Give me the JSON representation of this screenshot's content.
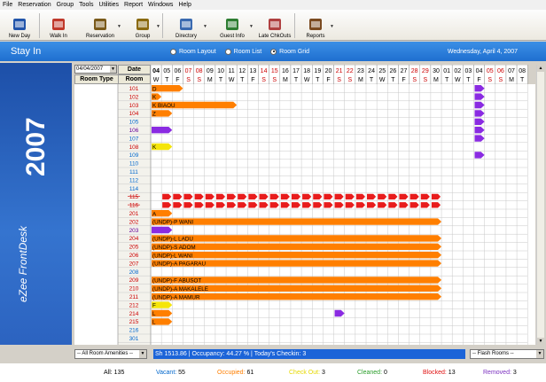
{
  "menu": [
    "File",
    "Reservation",
    "Group",
    "Tools",
    "Utilities",
    "Report",
    "Windows",
    "Help"
  ],
  "toolbar": [
    {
      "label": "New Day",
      "icon": "calendar-icon",
      "dropdown": false
    },
    {
      "label": "Walk In",
      "icon": "walk-in-icon",
      "dropdown": false
    },
    {
      "label": "Reservation",
      "icon": "reservation-icon",
      "dropdown": true
    },
    {
      "label": "Group",
      "icon": "group-icon",
      "dropdown": true
    },
    {
      "label": "Directory",
      "icon": "directory-icon",
      "dropdown": true
    },
    {
      "label": "Guest Info",
      "icon": "guest-info-icon",
      "dropdown": true
    },
    {
      "label": "Late ChkOuts",
      "icon": "late-checkout-icon",
      "dropdown": false
    },
    {
      "label": "Reports",
      "icon": "reports-icon",
      "dropdown": true
    }
  ],
  "window": {
    "title": "Stay In",
    "date": "Wednesday, April 4, 2007"
  },
  "view_options": [
    {
      "label": "Room Layout",
      "selected": false
    },
    {
      "label": "Room List",
      "selected": false
    },
    {
      "label": "Room Grid",
      "selected": true
    }
  ],
  "sidebar": {
    "logo_text": "eZee FrontDesk",
    "logo_year": "2007"
  },
  "grid": {
    "date_select": "04/04/2007",
    "date_header": "Date",
    "room_type_header": "Room Type",
    "room_header": "Room",
    "room_type_value": "",
    "days": [
      {
        "n": "04",
        "d": "W",
        "c": "#000"
      },
      {
        "n": "05",
        "d": "T",
        "c": "#000"
      },
      {
        "n": "06",
        "d": "F",
        "c": "#000"
      },
      {
        "n": "07",
        "d": "S",
        "c": "#c00"
      },
      {
        "n": "08",
        "d": "S",
        "c": "#c00"
      },
      {
        "n": "09",
        "d": "M",
        "c": "#000"
      },
      {
        "n": "10",
        "d": "T",
        "c": "#000"
      },
      {
        "n": "11",
        "d": "W",
        "c": "#000"
      },
      {
        "n": "12",
        "d": "T",
        "c": "#000"
      },
      {
        "n": "13",
        "d": "F",
        "c": "#000"
      },
      {
        "n": "14",
        "d": "S",
        "c": "#c00"
      },
      {
        "n": "15",
        "d": "S",
        "c": "#c00"
      },
      {
        "n": "16",
        "d": "M",
        "c": "#000"
      },
      {
        "n": "17",
        "d": "T",
        "c": "#000"
      },
      {
        "n": "18",
        "d": "W",
        "c": "#000"
      },
      {
        "n": "19",
        "d": "T",
        "c": "#000"
      },
      {
        "n": "20",
        "d": "F",
        "c": "#000"
      },
      {
        "n": "21",
        "d": "S",
        "c": "#c00"
      },
      {
        "n": "22",
        "d": "S",
        "c": "#c00"
      },
      {
        "n": "23",
        "d": "M",
        "c": "#000"
      },
      {
        "n": "24",
        "d": "T",
        "c": "#000"
      },
      {
        "n": "25",
        "d": "W",
        "c": "#000"
      },
      {
        "n": "26",
        "d": "T",
        "c": "#000"
      },
      {
        "n": "27",
        "d": "F",
        "c": "#000"
      },
      {
        "n": "28",
        "d": "S",
        "c": "#c00"
      },
      {
        "n": "29",
        "d": "S",
        "c": "#c00"
      },
      {
        "n": "30",
        "d": "M",
        "c": "#000"
      },
      {
        "n": "01",
        "d": "T",
        "c": "#000"
      },
      {
        "n": "02",
        "d": "W",
        "c": "#000"
      },
      {
        "n": "03",
        "d": "T",
        "c": "#000"
      },
      {
        "n": "04",
        "d": "F",
        "c": "#000"
      },
      {
        "n": "05",
        "d": "S",
        "c": "#c00"
      },
      {
        "n": "06",
        "d": "S",
        "c": "#c00"
      },
      {
        "n": "07",
        "d": "M",
        "c": "#000"
      },
      {
        "n": "08",
        "d": "T",
        "c": "#000"
      }
    ],
    "rooms": [
      {
        "no": "101",
        "c": "#c00"
      },
      {
        "no": "102",
        "c": "#c00"
      },
      {
        "no": "103",
        "c": "#c00"
      },
      {
        "no": "104",
        "c": "#c00"
      },
      {
        "no": "105",
        "c": "#06c"
      },
      {
        "no": "106",
        "c": "#609"
      },
      {
        "no": "107",
        "c": "#06c"
      },
      {
        "no": "108",
        "c": "#c00"
      },
      {
        "no": "109",
        "c": "#06c"
      },
      {
        "no": "110",
        "c": "#06c"
      },
      {
        "no": "111",
        "c": "#06c"
      },
      {
        "no": "112",
        "c": "#06c"
      },
      {
        "no": "114",
        "c": "#06c"
      },
      {
        "no": "115",
        "c": "#c00",
        "strike": true
      },
      {
        "no": "116",
        "c": "#c00",
        "strike": true
      },
      {
        "no": "201",
        "c": "#c00"
      },
      {
        "no": "202",
        "c": "#c00"
      },
      {
        "no": "203",
        "c": "#609"
      },
      {
        "no": "204",
        "c": "#c00"
      },
      {
        "no": "205",
        "c": "#c00"
      },
      {
        "no": "206",
        "c": "#c00"
      },
      {
        "no": "207",
        "c": "#c00"
      },
      {
        "no": "208",
        "c": "#06c"
      },
      {
        "no": "209",
        "c": "#c00"
      },
      {
        "no": "210",
        "c": "#c00"
      },
      {
        "no": "211",
        "c": "#c00"
      },
      {
        "no": "212",
        "c": "#c00"
      },
      {
        "no": "214",
        "c": "#c00"
      },
      {
        "no": "215",
        "c": "#c00"
      },
      {
        "no": "216",
        "c": "#06c"
      },
      {
        "no": "301",
        "c": "#06c"
      }
    ],
    "bookings": [
      {
        "row": 0,
        "start": 0,
        "end": 3,
        "color": "#ff7f00",
        "label": "D"
      },
      {
        "row": 1,
        "start": 0,
        "end": 1,
        "color": "#ff7f00",
        "label": "K"
      },
      {
        "row": 2,
        "start": 0,
        "end": 8,
        "color": "#ff7f00",
        "label": "K BIAOU"
      },
      {
        "row": 3,
        "start": 0,
        "end": 2,
        "color": "#ff7f00",
        "label": "Z"
      },
      {
        "row": 5,
        "start": 0,
        "end": 2,
        "color": "#8a2be2",
        "label": ""
      },
      {
        "row": 7,
        "start": 0,
        "end": 2,
        "color": "#f5e50a",
        "label": "K"
      },
      {
        "row": 15,
        "start": 0,
        "end": 2,
        "color": "#ff7f00",
        "label": "A"
      },
      {
        "row": 16,
        "start": 0,
        "end": 27,
        "color": "#ff7f00",
        "label": "(UNDP)-P WANI"
      },
      {
        "row": 17,
        "start": 0,
        "end": 2,
        "color": "#8a2be2",
        "label": ""
      },
      {
        "row": 18,
        "start": 0,
        "end": 27,
        "color": "#ff7f00",
        "label": "(UNDP)-L LADU"
      },
      {
        "row": 19,
        "start": 0,
        "end": 27,
        "color": "#ff7f00",
        "label": "(UNDP)-S ADOM"
      },
      {
        "row": 20,
        "start": 0,
        "end": 27,
        "color": "#ff7f00",
        "label": "(UNDP)-L WANI"
      },
      {
        "row": 21,
        "start": 0,
        "end": 27,
        "color": "#ff7f00",
        "label": "(UNDP)-A PAGARAU"
      },
      {
        "row": 23,
        "start": 0,
        "end": 27,
        "color": "#ff7f00",
        "label": "(UNDP)-F ABUSOT"
      },
      {
        "row": 24,
        "start": 0,
        "end": 27,
        "color": "#ff7f00",
        "label": "(UNDP)-A MAKALELE"
      },
      {
        "row": 25,
        "start": 0,
        "end": 27,
        "color": "#ff7f00",
        "label": "(UNDP)-A MAMUR"
      },
      {
        "row": 26,
        "start": 0,
        "end": 2,
        "color": "#f5e50a",
        "label": "F"
      },
      {
        "row": 27,
        "start": 0,
        "end": 2,
        "color": "#ff7f00",
        "label": "L"
      },
      {
        "row": 28,
        "start": 0,
        "end": 2,
        "color": "#ff7f00",
        "label": "L"
      },
      {
        "row": 27,
        "start": 17,
        "end": 18,
        "color": "#8a2be2",
        "label": ""
      },
      {
        "row": 0,
        "start": 30,
        "end": 31,
        "color": "#8a2be2",
        "label": ""
      },
      {
        "row": 1,
        "start": 30,
        "end": 31,
        "color": "#8a2be2",
        "label": ""
      },
      {
        "row": 2,
        "start": 30,
        "end": 31,
        "color": "#8a2be2",
        "label": ""
      },
      {
        "row": 3,
        "start": 30,
        "end": 31,
        "color": "#8a2be2",
        "label": ""
      },
      {
        "row": 4,
        "start": 30,
        "end": 31,
        "color": "#8a2be2",
        "label": ""
      },
      {
        "row": 5,
        "start": 30,
        "end": 31,
        "color": "#8a2be2",
        "label": ""
      },
      {
        "row": 6,
        "start": 30,
        "end": 31,
        "color": "#8a2be2",
        "label": ""
      },
      {
        "row": 8,
        "start": 30,
        "end": 31,
        "color": "#8a2be2",
        "label": ""
      }
    ],
    "blocked": {
      "rows": [
        13,
        14
      ],
      "start": 1,
      "end": 27,
      "color": "#e81c1c"
    }
  },
  "status": {
    "amenities": "-- All Room Amenities --",
    "stats": "Sh 1513.86 | Occupancy: 44.27 % | Today's Checkin: 3",
    "flash": "-- Flash Rooms --"
  },
  "legend": [
    {
      "label": "All:",
      "value": "135",
      "color": "#000"
    },
    {
      "label": "Vacant:",
      "value": "55",
      "color": "#06c"
    },
    {
      "label": "Occupied:",
      "value": "61",
      "color": "#ff7f00"
    },
    {
      "label": "Check Out:",
      "value": "3",
      "color": "#e6d800"
    },
    {
      "label": "Cleaned:",
      "value": "0",
      "color": "#2a9d2a"
    },
    {
      "label": "Blocked:",
      "value": "13",
      "color": "#e01010"
    },
    {
      "label": "Removed:",
      "value": "3",
      "color": "#7b2fbf"
    }
  ]
}
